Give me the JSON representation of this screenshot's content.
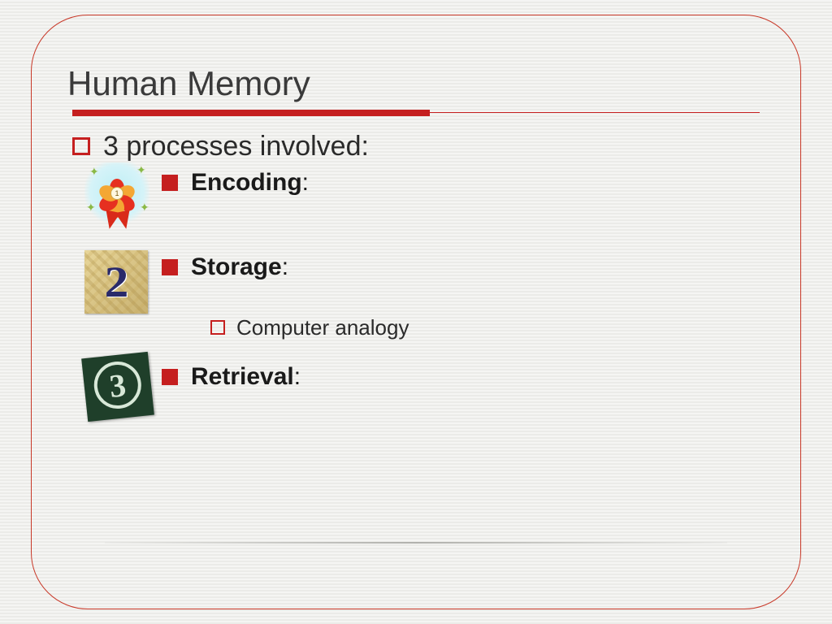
{
  "slide": {
    "title": "Human Memory",
    "main_bullet": "3 processes involved:",
    "items": [
      {
        "label": "Encoding",
        "suffix": ":"
      },
      {
        "label": "Storage",
        "suffix": ":"
      },
      {
        "label": "Retrieval",
        "suffix": ":"
      }
    ],
    "subitem": "Computer analogy"
  }
}
